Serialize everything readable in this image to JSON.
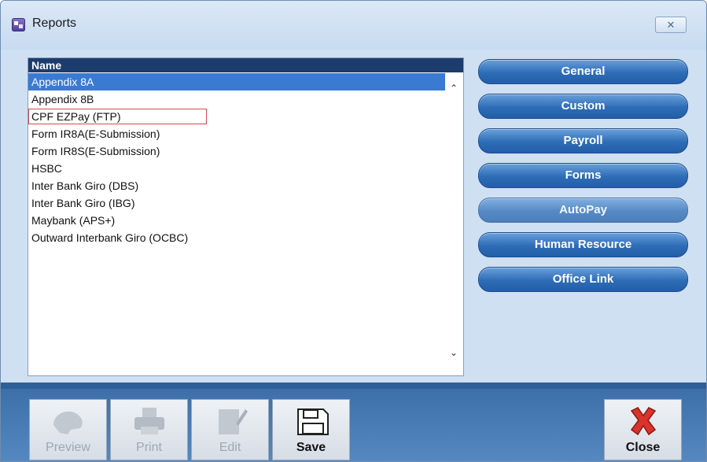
{
  "window": {
    "title": "Reports",
    "close_glyph": "✕"
  },
  "list": {
    "header": "Name",
    "items": [
      "Appendix 8A",
      "Appendix 8B",
      "CPF EZPay (FTP)",
      "Form IR8A(E-Submission)",
      "Form IR8S(E-Submission)",
      "HSBC",
      "Inter Bank Giro (DBS)",
      "Inter Bank Giro (IBG)",
      "Maybank (APS+)",
      "Outward Interbank Giro (OCBC)"
    ],
    "selected_index": 0,
    "highlighted_index": 2
  },
  "categories": [
    "General",
    "Custom",
    "Payroll",
    "Forms",
    "AutoPay",
    "Human Resource",
    "Office Link"
  ],
  "toolbar": {
    "preview": "Preview",
    "print": "Print",
    "edit": "Edit",
    "save": "Save",
    "close": "Close"
  },
  "colors": {
    "accent": "#2d6cb6",
    "selection": "#3b7ad2",
    "list_header": "#1d3c6e",
    "highlight_border": "#d44a4a",
    "close_icon": "#d9332b"
  },
  "icons": {
    "app": "reports-app-icon",
    "preview": "preview-icon",
    "print": "print-icon",
    "edit": "edit-icon",
    "save": "floppy-disk-icon",
    "close": "red-x-icon"
  }
}
